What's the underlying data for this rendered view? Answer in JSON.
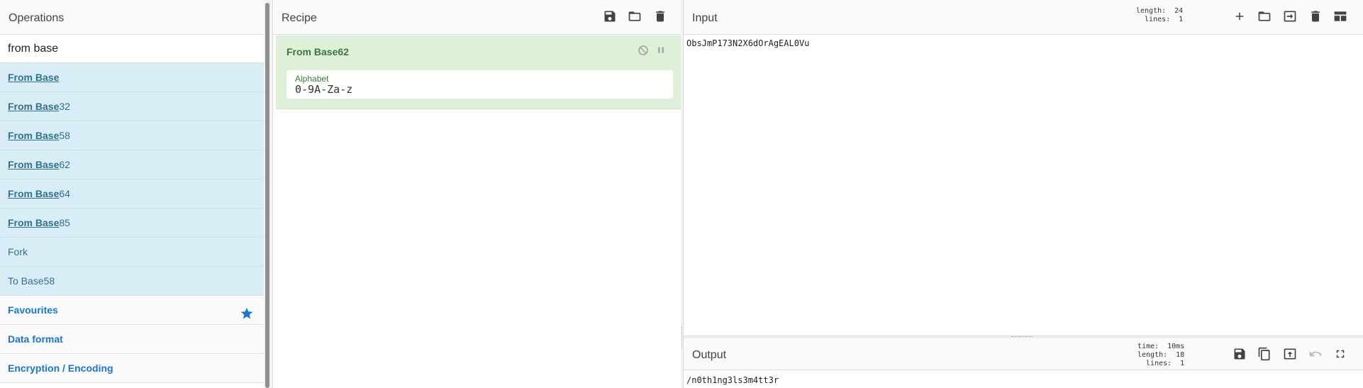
{
  "operations": {
    "title": "Operations",
    "search_value": "from base",
    "results": [
      {
        "match": "From Base",
        "rest": ""
      },
      {
        "match": "From Base",
        "rest": "32"
      },
      {
        "match": "From Base",
        "rest": "58"
      },
      {
        "match": "From Base",
        "rest": "62"
      },
      {
        "match": "From Base",
        "rest": "64"
      },
      {
        "match": "From Base",
        "rest": "85"
      },
      {
        "match": "",
        "rest": "Fork"
      },
      {
        "match": "",
        "rest": "To Base58"
      }
    ],
    "categories": [
      {
        "label": "Favourites",
        "icon": "star-icon"
      },
      {
        "label": "Data format"
      },
      {
        "label": "Encryption / Encoding"
      }
    ],
    "colors": {
      "result_bg": "#d9edf7",
      "result_text": "#31708f",
      "category_text": "#1976d2",
      "star": "#1976d2"
    }
  },
  "recipe": {
    "title": "Recipe",
    "toolbar_icons": [
      "save-icon",
      "folder-open-icon",
      "trash-icon"
    ],
    "operation": {
      "name": "From Base62",
      "arg_label": "Alphabet",
      "arg_value": "0-9A-Za-z",
      "icons": [
        "disable-icon",
        "pause-icon"
      ]
    },
    "colors": {
      "op_bg": "#dff0d8",
      "op_text": "#3c763d"
    }
  },
  "input": {
    "title": "Input",
    "stats": {
      "length_label": "length:",
      "length": "24",
      "lines_label": "lines:",
      "lines": "1"
    },
    "toolbar_icons": [
      "plus-icon",
      "folder-open-icon",
      "import-file-icon",
      "trash-icon",
      "layout-icon"
    ],
    "text": "ObsJmP173N2X6dOrAgEAL0Vu"
  },
  "output": {
    "title": "Output",
    "stats": {
      "time_label": "time:",
      "time": "10ms",
      "length_label": "length:",
      "length": "18",
      "lines_label": "lines:",
      "lines": "1"
    },
    "toolbar_icons": [
      "save-icon",
      "copy-icon",
      "replace-input-icon",
      "undo-icon",
      "maximise-icon"
    ],
    "text": "/n0th1ng3ls3m4tt3r"
  }
}
